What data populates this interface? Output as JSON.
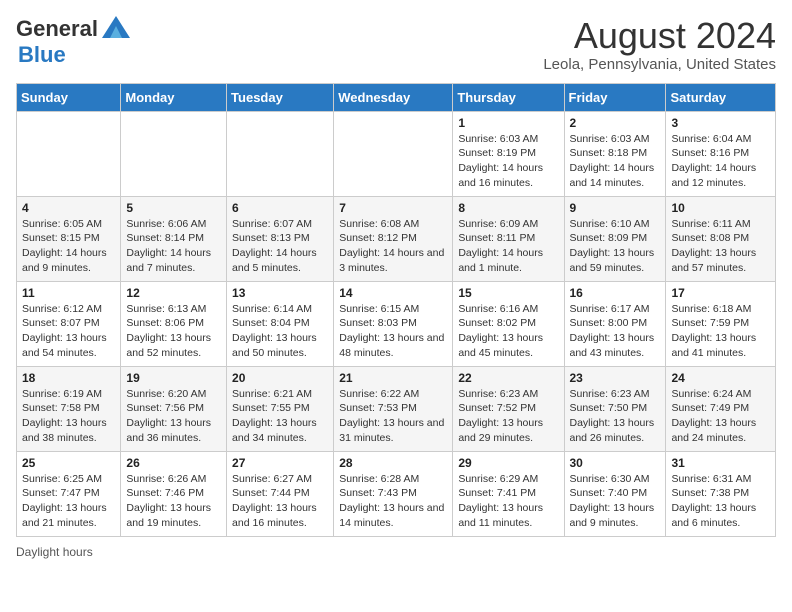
{
  "header": {
    "logo_general": "General",
    "logo_blue": "Blue",
    "month_title": "August 2024",
    "location": "Leola, Pennsylvania, United States"
  },
  "days_of_week": [
    "Sunday",
    "Monday",
    "Tuesday",
    "Wednesday",
    "Thursday",
    "Friday",
    "Saturday"
  ],
  "weeks": [
    [
      {
        "day": "",
        "sunrise": "",
        "sunset": "",
        "daylight": ""
      },
      {
        "day": "",
        "sunrise": "",
        "sunset": "",
        "daylight": ""
      },
      {
        "day": "",
        "sunrise": "",
        "sunset": "",
        "daylight": ""
      },
      {
        "day": "",
        "sunrise": "",
        "sunset": "",
        "daylight": ""
      },
      {
        "day": "1",
        "sunrise": "Sunrise: 6:03 AM",
        "sunset": "Sunset: 8:19 PM",
        "daylight": "Daylight: 14 hours and 16 minutes."
      },
      {
        "day": "2",
        "sunrise": "Sunrise: 6:03 AM",
        "sunset": "Sunset: 8:18 PM",
        "daylight": "Daylight: 14 hours and 14 minutes."
      },
      {
        "day": "3",
        "sunrise": "Sunrise: 6:04 AM",
        "sunset": "Sunset: 8:16 PM",
        "daylight": "Daylight: 14 hours and 12 minutes."
      }
    ],
    [
      {
        "day": "4",
        "sunrise": "Sunrise: 6:05 AM",
        "sunset": "Sunset: 8:15 PM",
        "daylight": "Daylight: 14 hours and 9 minutes."
      },
      {
        "day": "5",
        "sunrise": "Sunrise: 6:06 AM",
        "sunset": "Sunset: 8:14 PM",
        "daylight": "Daylight: 14 hours and 7 minutes."
      },
      {
        "day": "6",
        "sunrise": "Sunrise: 6:07 AM",
        "sunset": "Sunset: 8:13 PM",
        "daylight": "Daylight: 14 hours and 5 minutes."
      },
      {
        "day": "7",
        "sunrise": "Sunrise: 6:08 AM",
        "sunset": "Sunset: 8:12 PM",
        "daylight": "Daylight: 14 hours and 3 minutes."
      },
      {
        "day": "8",
        "sunrise": "Sunrise: 6:09 AM",
        "sunset": "Sunset: 8:11 PM",
        "daylight": "Daylight: 14 hours and 1 minute."
      },
      {
        "day": "9",
        "sunrise": "Sunrise: 6:10 AM",
        "sunset": "Sunset: 8:09 PM",
        "daylight": "Daylight: 13 hours and 59 minutes."
      },
      {
        "day": "10",
        "sunrise": "Sunrise: 6:11 AM",
        "sunset": "Sunset: 8:08 PM",
        "daylight": "Daylight: 13 hours and 57 minutes."
      }
    ],
    [
      {
        "day": "11",
        "sunrise": "Sunrise: 6:12 AM",
        "sunset": "Sunset: 8:07 PM",
        "daylight": "Daylight: 13 hours and 54 minutes."
      },
      {
        "day": "12",
        "sunrise": "Sunrise: 6:13 AM",
        "sunset": "Sunset: 8:06 PM",
        "daylight": "Daylight: 13 hours and 52 minutes."
      },
      {
        "day": "13",
        "sunrise": "Sunrise: 6:14 AM",
        "sunset": "Sunset: 8:04 PM",
        "daylight": "Daylight: 13 hours and 50 minutes."
      },
      {
        "day": "14",
        "sunrise": "Sunrise: 6:15 AM",
        "sunset": "Sunset: 8:03 PM",
        "daylight": "Daylight: 13 hours and 48 minutes."
      },
      {
        "day": "15",
        "sunrise": "Sunrise: 6:16 AM",
        "sunset": "Sunset: 8:02 PM",
        "daylight": "Daylight: 13 hours and 45 minutes."
      },
      {
        "day": "16",
        "sunrise": "Sunrise: 6:17 AM",
        "sunset": "Sunset: 8:00 PM",
        "daylight": "Daylight: 13 hours and 43 minutes."
      },
      {
        "day": "17",
        "sunrise": "Sunrise: 6:18 AM",
        "sunset": "Sunset: 7:59 PM",
        "daylight": "Daylight: 13 hours and 41 minutes."
      }
    ],
    [
      {
        "day": "18",
        "sunrise": "Sunrise: 6:19 AM",
        "sunset": "Sunset: 7:58 PM",
        "daylight": "Daylight: 13 hours and 38 minutes."
      },
      {
        "day": "19",
        "sunrise": "Sunrise: 6:20 AM",
        "sunset": "Sunset: 7:56 PM",
        "daylight": "Daylight: 13 hours and 36 minutes."
      },
      {
        "day": "20",
        "sunrise": "Sunrise: 6:21 AM",
        "sunset": "Sunset: 7:55 PM",
        "daylight": "Daylight: 13 hours and 34 minutes."
      },
      {
        "day": "21",
        "sunrise": "Sunrise: 6:22 AM",
        "sunset": "Sunset: 7:53 PM",
        "daylight": "Daylight: 13 hours and 31 minutes."
      },
      {
        "day": "22",
        "sunrise": "Sunrise: 6:23 AM",
        "sunset": "Sunset: 7:52 PM",
        "daylight": "Daylight: 13 hours and 29 minutes."
      },
      {
        "day": "23",
        "sunrise": "Sunrise: 6:23 AM",
        "sunset": "Sunset: 7:50 PM",
        "daylight": "Daylight: 13 hours and 26 minutes."
      },
      {
        "day": "24",
        "sunrise": "Sunrise: 6:24 AM",
        "sunset": "Sunset: 7:49 PM",
        "daylight": "Daylight: 13 hours and 24 minutes."
      }
    ],
    [
      {
        "day": "25",
        "sunrise": "Sunrise: 6:25 AM",
        "sunset": "Sunset: 7:47 PM",
        "daylight": "Daylight: 13 hours and 21 minutes."
      },
      {
        "day": "26",
        "sunrise": "Sunrise: 6:26 AM",
        "sunset": "Sunset: 7:46 PM",
        "daylight": "Daylight: 13 hours and 19 minutes."
      },
      {
        "day": "27",
        "sunrise": "Sunrise: 6:27 AM",
        "sunset": "Sunset: 7:44 PM",
        "daylight": "Daylight: 13 hours and 16 minutes."
      },
      {
        "day": "28",
        "sunrise": "Sunrise: 6:28 AM",
        "sunset": "Sunset: 7:43 PM",
        "daylight": "Daylight: 13 hours and 14 minutes."
      },
      {
        "day": "29",
        "sunrise": "Sunrise: 6:29 AM",
        "sunset": "Sunset: 7:41 PM",
        "daylight": "Daylight: 13 hours and 11 minutes."
      },
      {
        "day": "30",
        "sunrise": "Sunrise: 6:30 AM",
        "sunset": "Sunset: 7:40 PM",
        "daylight": "Daylight: 13 hours and 9 minutes."
      },
      {
        "day": "31",
        "sunrise": "Sunrise: 6:31 AM",
        "sunset": "Sunset: 7:38 PM",
        "daylight": "Daylight: 13 hours and 6 minutes."
      }
    ]
  ],
  "footer": {
    "daylight_hours_label": "Daylight hours"
  }
}
